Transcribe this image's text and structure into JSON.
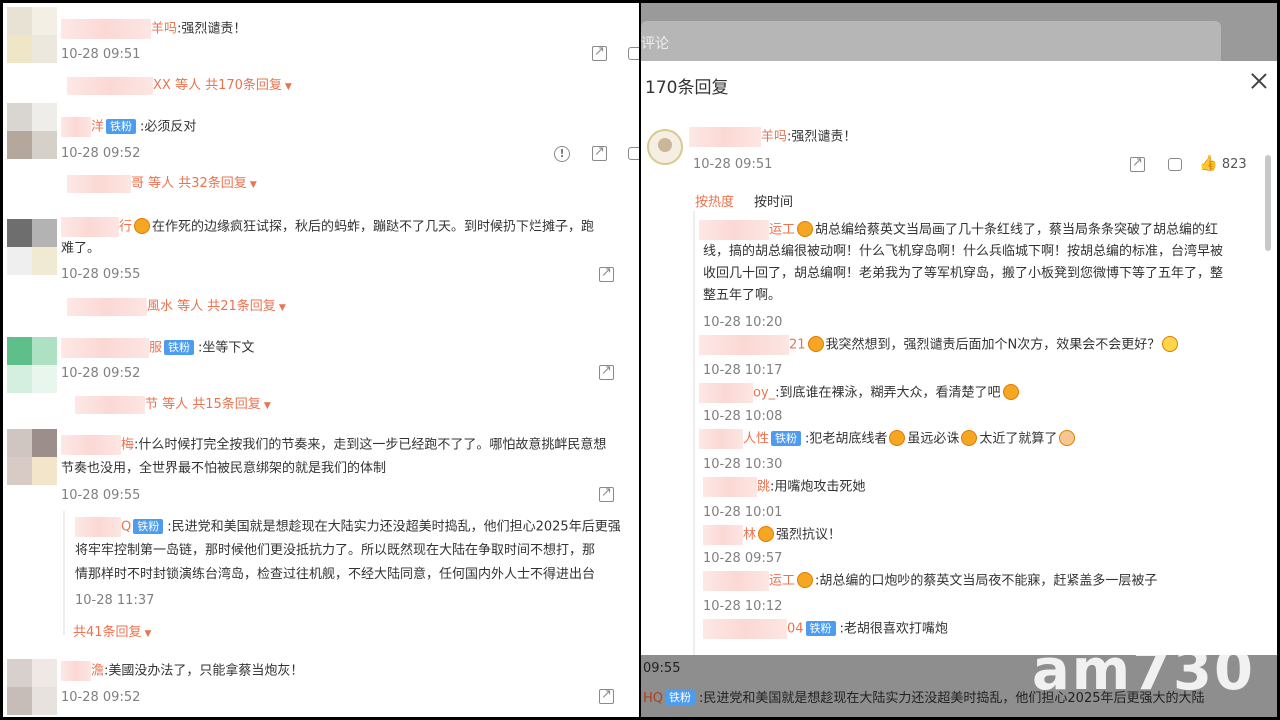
{
  "left": {
    "comments": [
      {
        "name": "羊吗",
        "badge": "",
        "text": ":强烈谴责！",
        "time": "10-28 09:51",
        "replies": "XX 等人 共170条回复"
      },
      {
        "name": "洋",
        "badge": "铁粉",
        "text": ":必须反对",
        "time": "10-28 09:52",
        "replies": "哥 等人 共32条回复"
      },
      {
        "name": "行",
        "badge": "",
        "text": "在作死的边缘疯狂试探，秋后的蚂蚱，蹦跶不了几天。到时候扔下烂摊子，跑",
        "text2": "难了。",
        "time": "10-28 09:55",
        "replies": "風水 等人 共21条回复"
      },
      {
        "name": "服",
        "badge": "铁粉",
        "text": ":坐等下文",
        "time": "10-28 09:52",
        "replies": "节 等人 共15条回复"
      },
      {
        "name": "梅",
        "badge": "",
        "text": ":什么时候打完全按我们的节奏来，走到这一步已经跑不了了。哪怕故意挑衅民意想",
        "text2": "节奏也没用，全世界最不怕被民意绑架的就是我们的体制",
        "time": "10-28 09:55"
      },
      {
        "name": "澹",
        "badge": "",
        "text": ":美國没办法了，只能拿蔡当炮灰！",
        "time": "10-28 09:52"
      }
    ],
    "sub": {
      "name": "Q",
      "badge": "铁粉",
      "l1": ":民进党和美国就是想趁现在大陆实力还没超美时捣乱，他们担心2025年后更强",
      "l2": "将牢牢控制第一岛链，那时候他们更没抵抗力了。所以既然现在大陆在争取时间不想打，那",
      "l3": "情那样时不时封锁演练台湾岛，检查过往机舰，不经大陆同意，任何国内外人士不得进出台",
      "time": "10-28 11:37",
      "more": "共41条回复"
    }
  },
  "right": {
    "bg_label": "评论",
    "title": "170条回复",
    "main": {
      "name": "羊吗",
      "text": ":强烈谴责！",
      "time": "10-28 09:51",
      "likes": "823"
    },
    "tabs": {
      "hot": "按热度",
      "time": "按时间"
    },
    "replies": [
      {
        "name": "运工",
        "l1": "胡总编给蔡英文当局画了几十条红线了，蔡当局条条突破了胡总编的红",
        "l2": "线，搞的胡总编很被动啊！什么飞机穿岛啊！什么兵临城下啊！按胡总编的标准，台湾早被",
        "l3": "收回几十回了，胡总编啊！老弟我为了等军机穿岛，搬了小板凳到您微博下等了五年了，整",
        "l4": "整五年了啊。",
        "time": "10-28 10:20"
      },
      {
        "name": "21",
        "l1": "我突然想到，强烈谴责后面加个N次方，效果会不会更好？",
        "time": "10-28 10:17"
      },
      {
        "name": "oy_",
        "l1": ":到底谁在裸泳，糊弄大众，看清楚了吧",
        "time": "10-28 10:08"
      },
      {
        "name": "人性",
        "badge": "铁粉",
        "l1": ":犯老胡底线者",
        "l1b": "虽远必诛",
        "l1c": "太近了就算了",
        "time": "10-28 10:30"
      },
      {
        "name": "跳",
        "l1": ":用嘴炮攻击死她",
        "time": "10-28 10:01"
      },
      {
        "name": "林",
        "l1": "强烈抗议！",
        "time": "10-28 09:57"
      },
      {
        "name": "运工",
        "l1": ":胡总编的口炮吵的蔡英文当局夜不能寐，赶紧盖多一层被子",
        "time": "10-28 10:12"
      },
      {
        "name": "04",
        "badge": "铁粉",
        "l1": ":老胡很喜欢打嘴炮"
      }
    ],
    "bottom": {
      "time": "09:55",
      "name": "HQ",
      "badge": "铁粉",
      "text": ":民进党和美国就是想趁现在大陆实力还没超美时捣乱，他们担心2025年后更强大的大陆"
    },
    "watermark": "am730"
  }
}
